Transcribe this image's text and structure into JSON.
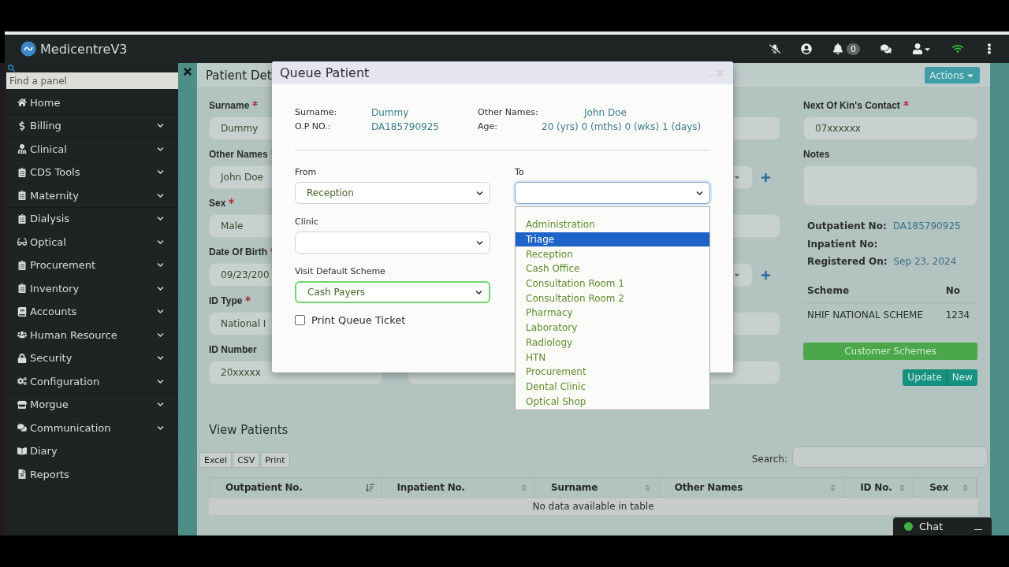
{
  "topbar": {
    "app_name": "MedicentreV3",
    "notification_count": "0"
  },
  "sidebar": {
    "search": {
      "placeholder": "Find a panel"
    },
    "items": [
      {
        "label": "Home",
        "expandable": false
      },
      {
        "label": "Billing",
        "expandable": true
      },
      {
        "label": "Clinical",
        "expandable": true
      },
      {
        "label": "CDS Tools",
        "expandable": true
      },
      {
        "label": "Maternity",
        "expandable": true
      },
      {
        "label": "Dialysis",
        "expandable": true
      },
      {
        "label": "Optical",
        "expandable": true
      },
      {
        "label": "Procurement",
        "expandable": true
      },
      {
        "label": "Inventory",
        "expandable": true
      },
      {
        "label": "Accounts",
        "expandable": true
      },
      {
        "label": "Human Resource",
        "expandable": true
      },
      {
        "label": "Security",
        "expandable": true
      },
      {
        "label": "Configuration",
        "expandable": true
      },
      {
        "label": "Morgue",
        "expandable": true
      },
      {
        "label": "Communication",
        "expandable": true
      },
      {
        "label": "Diary",
        "expandable": false
      },
      {
        "label": "Reports",
        "expandable": false
      }
    ]
  },
  "patient_panel": {
    "title": "Patient Det",
    "actions_button": "Actions",
    "left_fields": [
      {
        "label": "Surname",
        "required": true,
        "value": "Dummy"
      },
      {
        "label": "Other Names",
        "required": true,
        "value": "John Doe"
      },
      {
        "label": "Sex",
        "required": true,
        "value": "Male"
      },
      {
        "label": "Date Of Birth",
        "required": true,
        "value": "09/23/200"
      },
      {
        "label": "ID Type",
        "required": true,
        "value": "National I"
      },
      {
        "label": "ID Number",
        "required": false,
        "value": "20xxxxx"
      }
    ],
    "middle_fields": [
      {
        "kind": "input"
      },
      {
        "kind": "select"
      },
      {
        "kind": "input"
      },
      {
        "kind": "select"
      },
      {
        "kind": "input"
      },
      {
        "kind": "input"
      }
    ],
    "next_of_kin_contact": {
      "label": "Next Of Kin's Contact",
      "required": true,
      "value": "07xxxxxx"
    },
    "notes": {
      "label": "Notes"
    },
    "info": [
      {
        "label": "Outpatient No:",
        "value": "DA185790925"
      },
      {
        "label": "Inpatient No:"
      },
      {
        "label": "Registered On:",
        "value": "Sep 23, 2024"
      }
    ],
    "schemes": {
      "columns": [
        "Scheme",
        "No"
      ],
      "rows": [
        [
          "NHIF NATIONAL SCHEME",
          "1234"
        ]
      ]
    },
    "customer_schemes_button": "Customer Schemes",
    "buttons": [
      "Update",
      "New"
    ]
  },
  "view_patients": {
    "title": "View Patients",
    "export_buttons": [
      "Excel",
      "CSV",
      "Print"
    ],
    "search_label": "Search:",
    "columns": [
      {
        "label": "Outpatient No.",
        "sorted": true
      },
      {
        "label": "Inpatient No.",
        "sorted": false
      },
      {
        "label": "Surname",
        "sorted": false
      },
      {
        "label": "Other Names",
        "sorted": false
      },
      {
        "label": "ID No.",
        "sorted": false
      },
      {
        "label": "Sex",
        "sorted": false
      }
    ],
    "empty_message": "No data available in table"
  },
  "chat": {
    "label": "Chat",
    "online": true
  },
  "modal": {
    "title": "Queue Patient",
    "patient": [
      {
        "label": "Surname:",
        "value": "Dummy"
      },
      {
        "label": "Other Names:",
        "value": "John Doe"
      },
      {
        "label": "O.P NO.:",
        "value": "DA185790925"
      },
      {
        "label": "Age:",
        "value": "20 (yrs) 0 (mths) 0 (wks) 1 (days)"
      }
    ],
    "from": {
      "label": "From",
      "value": "Reception"
    },
    "to": {
      "label": "To",
      "expanded": true,
      "options": [
        {
          "label": "Administration",
          "selected": false
        },
        {
          "label": "Triage",
          "selected": true
        },
        {
          "label": "Reception",
          "selected": false
        },
        {
          "label": "Cash Office",
          "selected": false
        },
        {
          "label": "Consultation Room 1",
          "selected": false
        },
        {
          "label": "Consultation Room 2",
          "selected": false
        },
        {
          "label": "Pharmacy",
          "selected": false
        },
        {
          "label": "Laboratory",
          "selected": false
        },
        {
          "label": "Radiology",
          "selected": false
        },
        {
          "label": "HTN",
          "selected": false
        },
        {
          "label": "Procurement",
          "selected": false
        },
        {
          "label": "Dental Clinic",
          "selected": false
        },
        {
          "label": "Optical Shop",
          "selected": false
        }
      ]
    },
    "clinic": {
      "label": "Clinic"
    },
    "scheme": {
      "label": "Visit Default Scheme",
      "value": "Cash Payers",
      "valid": true
    },
    "print_ticket": {
      "label": "Print Queue Ticket",
      "checked": false
    }
  }
}
